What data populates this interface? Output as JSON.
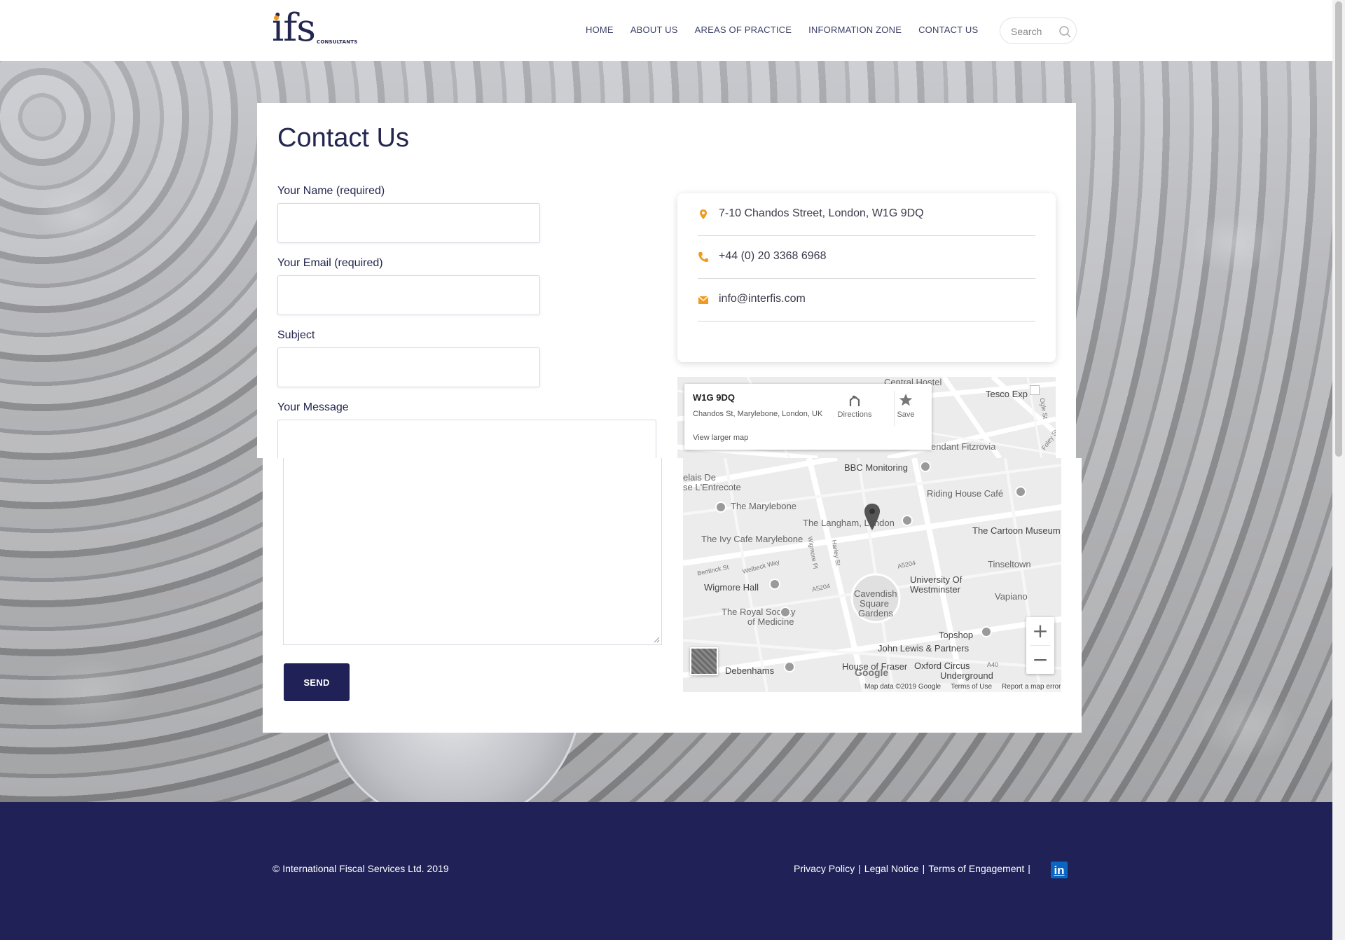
{
  "header": {
    "logo_text": "ifs",
    "logo_subtext": "CONSULTANTS",
    "nav": [
      "HOME",
      "ABOUT US",
      "AREAS OF PRACTICE",
      "INFORMATION ZONE",
      "CONTACT US"
    ],
    "search_placeholder": "Search"
  },
  "form": {
    "title": "Contact Us",
    "name_label": "Your Name (required)",
    "email_label": "Your Email (required)",
    "subject_label": "Subject",
    "message_label": "Your Message",
    "send_label": "SEND"
  },
  "contact": {
    "address": "7-10 Chandos Street, London, W1G 9DQ",
    "phone": "+44 (0) 20 3368 6968",
    "email": "info@interfis.com"
  },
  "map": {
    "popup_title": "W1G 9DQ",
    "popup_address": "Chandos St, Marylebone, London, UK",
    "directions_label": "Directions",
    "save_label": "Save",
    "larger_map_label": "View larger map",
    "labels_top": [
      "Central Hostel",
      "Tesco Exp",
      "endant Fitzrovia"
    ],
    "labels": [
      "BBC Monitoring",
      "elais De",
      "se L'Entrecote",
      "Riding House Café",
      "The Marylebone",
      "The Langham, London",
      "The Cartoon Museum",
      "The Ivy Cafe Marylebone",
      "Bentinck St",
      "Welbeck Way",
      "Wigmore Pl",
      "Harley St",
      "A5204",
      "Tinseltown",
      "Wigmore Hall",
      "A5204",
      "University Of",
      "Westminster",
      "Cavendish",
      "Square",
      "Gardens",
      "Vapiano",
      "The Royal Society",
      "of Medicine",
      "Topshop",
      "John Lewis & Partners",
      "Debenhams",
      "House of Fraser",
      "Oxford Circus",
      "Underground",
      "A40"
    ],
    "street_labels_top": [
      "Ogle St",
      "Foley St"
    ],
    "google_mark": "Google",
    "footer": [
      "Map data ©2019 Google",
      "Terms of Use",
      "Report a map error"
    ],
    "zoom_in": "+",
    "zoom_out": "−"
  },
  "footer": {
    "copyright": "© International Fiscal Services Ltd. 2019",
    "links": [
      "Privacy Policy",
      "Legal Notice",
      "Terms of Engagement"
    ],
    "separator": "|",
    "linkedin_icon": "in"
  },
  "colors": {
    "brand_navy": "#1f2157",
    "accent_orange": "#f19a1f",
    "linkedin_blue": "#0a66c2"
  },
  "icons": [
    "search-icon",
    "map-pin-icon",
    "phone-icon",
    "envelope-icon",
    "directions-icon",
    "star-icon",
    "linkedin-icon",
    "pegman-icon",
    "fullscreen-icon"
  ]
}
